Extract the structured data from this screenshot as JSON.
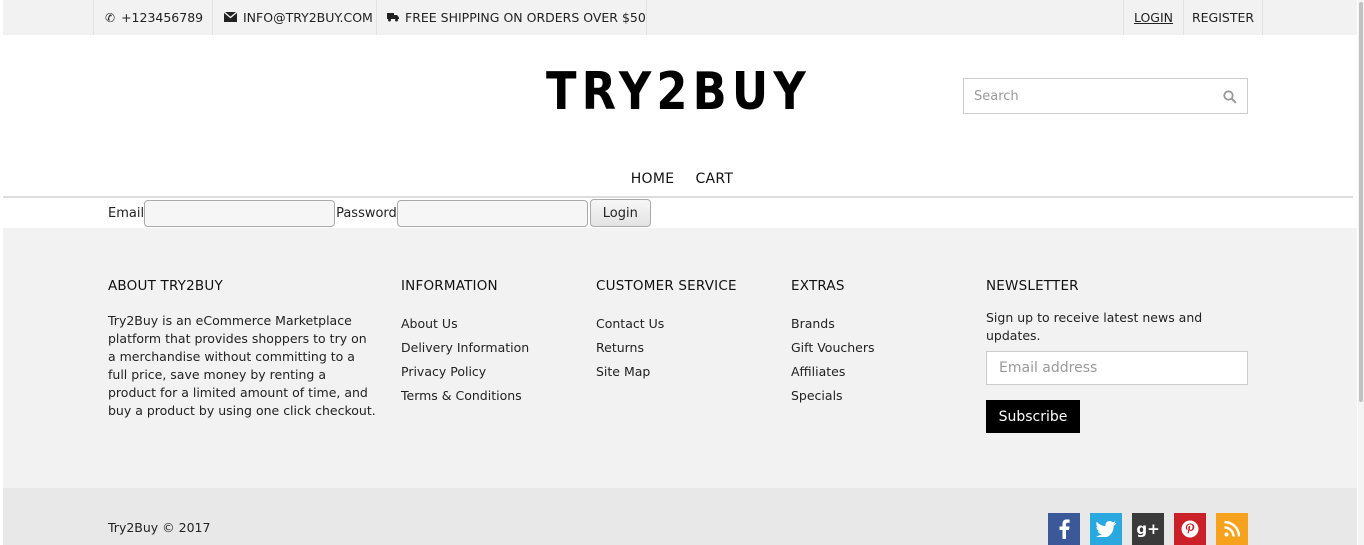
{
  "topbar": {
    "phone": "+123456789",
    "email": "INFO@TRY2BUY.COM",
    "shipping": "FREE SHIPPING ON ORDERS OVER $50",
    "login": "LOGIN",
    "register": "REGISTER"
  },
  "header": {
    "logo": "TRY2BUY",
    "search_placeholder": "Search"
  },
  "nav": {
    "items": [
      "HOME",
      "CART"
    ]
  },
  "login_form": {
    "email_label": "Email",
    "password_label": "Password",
    "button": "Login"
  },
  "footer": {
    "about": {
      "title": "ABOUT TRY2BUY",
      "text": "Try2Buy is an eCommerce Marketplace platform that provides shoppers to try on a merchandise without committing to a full price, save money by renting a product for a limited amount of time, and buy a product by using one click checkout."
    },
    "information": {
      "title": "INFORMATION",
      "links": [
        "About Us",
        "Delivery Information",
        "Privacy Policy",
        "Terms & Conditions"
      ]
    },
    "customer_service": {
      "title": "CUSTOMER SERVICE",
      "links": [
        "Contact Us",
        "Returns",
        "Site Map"
      ]
    },
    "extras": {
      "title": "EXTRAS",
      "links": [
        "Brands",
        "Gift Vouchers",
        "Affiliates",
        "Specials"
      ]
    },
    "newsletter": {
      "title": "NEWSLETTER",
      "text": "Sign up to receive latest news and updates.",
      "placeholder": "Email address",
      "button": "Subscribe"
    },
    "copyright": "Try2Buy © 2017",
    "social_icons": [
      "facebook-icon",
      "twitter-icon",
      "google-plus-icon",
      "pinterest-icon",
      "rss-icon"
    ]
  },
  "colors": {
    "facebook": "#3b5998",
    "twitter": "#2aa9e0",
    "google_plus": "#3a3a3a",
    "pinterest": "#cb2027",
    "rss": "#f6a21c"
  }
}
